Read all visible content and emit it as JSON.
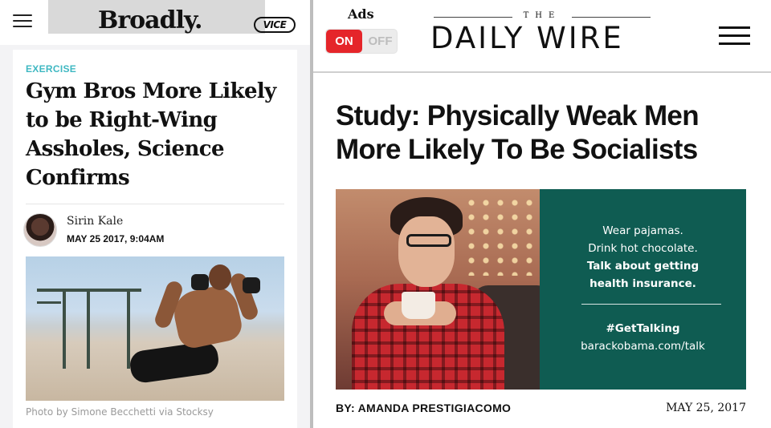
{
  "broadly": {
    "logo": "Broadly.",
    "partner_logo": "VICE",
    "article": {
      "kicker": "EXERCISE",
      "headline": "Gym Bros More Likely to be Right-Wing Assholes, Science Confirms",
      "author": "Sirin Kale",
      "date": "MAY 25 2017, 9:04AM",
      "photo_credit": "Photo by Simone Becchetti via Stocksy"
    }
  },
  "dailywire": {
    "ads": {
      "label": "Ads",
      "on_label": "ON",
      "off_label": "OFF",
      "state": "ON"
    },
    "logo_small": "THE",
    "logo": "DAILY WIRE",
    "article": {
      "headline": "Study: Physically Weak Men More Likely To Be Socialists",
      "byline": "BY: AMANDA PRESTIGIACOMO",
      "date": "MAY 25, 2017"
    },
    "ad_banner": {
      "line1": "Wear pajamas.",
      "line2": "Drink hot chocolate.",
      "line3": "Talk about getting",
      "line4": "health insurance.",
      "hashtag": "#GetTalking",
      "url": "barackobama.com/talk"
    }
  },
  "colors": {
    "kicker": "#3fb8c2",
    "toggle_on": "#e5252a",
    "ad_panel": "#0f5c52"
  }
}
